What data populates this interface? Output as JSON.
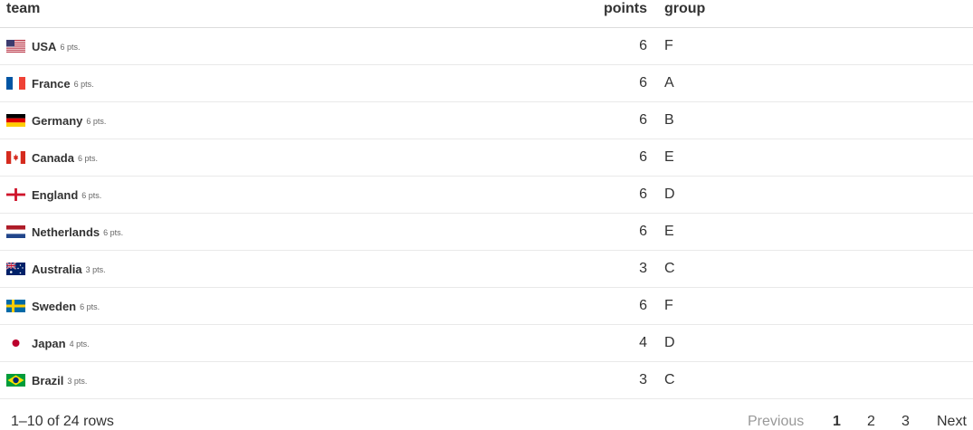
{
  "table": {
    "headers": {
      "team": "team",
      "points": "points",
      "group": "group"
    },
    "rows": [
      {
        "name": "USA",
        "pts_label": "6 pts.",
        "points": "6",
        "group": "F",
        "flag": "flag-usa"
      },
      {
        "name": "France",
        "pts_label": "6 pts.",
        "points": "6",
        "group": "A",
        "flag": "flag-france"
      },
      {
        "name": "Germany",
        "pts_label": "6 pts.",
        "points": "6",
        "group": "B",
        "flag": "flag-germany"
      },
      {
        "name": "Canada",
        "pts_label": "6 pts.",
        "points": "6",
        "group": "E",
        "flag": "flag-canada"
      },
      {
        "name": "England",
        "pts_label": "6 pts.",
        "points": "6",
        "group": "D",
        "flag": "flag-england"
      },
      {
        "name": "Netherlands",
        "pts_label": "6 pts.",
        "points": "6",
        "group": "E",
        "flag": "flag-netherlands"
      },
      {
        "name": "Australia",
        "pts_label": "3 pts.",
        "points": "3",
        "group": "C",
        "flag": "flag-australia"
      },
      {
        "name": "Sweden",
        "pts_label": "6 pts.",
        "points": "6",
        "group": "F",
        "flag": "flag-sweden"
      },
      {
        "name": "Japan",
        "pts_label": "4 pts.",
        "points": "4",
        "group": "D",
        "flag": "flag-japan"
      },
      {
        "name": "Brazil",
        "pts_label": "3 pts.",
        "points": "3",
        "group": "C",
        "flag": "flag-brazil"
      }
    ]
  },
  "footer": {
    "rows_info": "1–10 of 24 rows",
    "pagination": {
      "previous": "Previous",
      "pages": [
        "1",
        "2",
        "3"
      ],
      "current": "1",
      "next": "Next"
    }
  }
}
